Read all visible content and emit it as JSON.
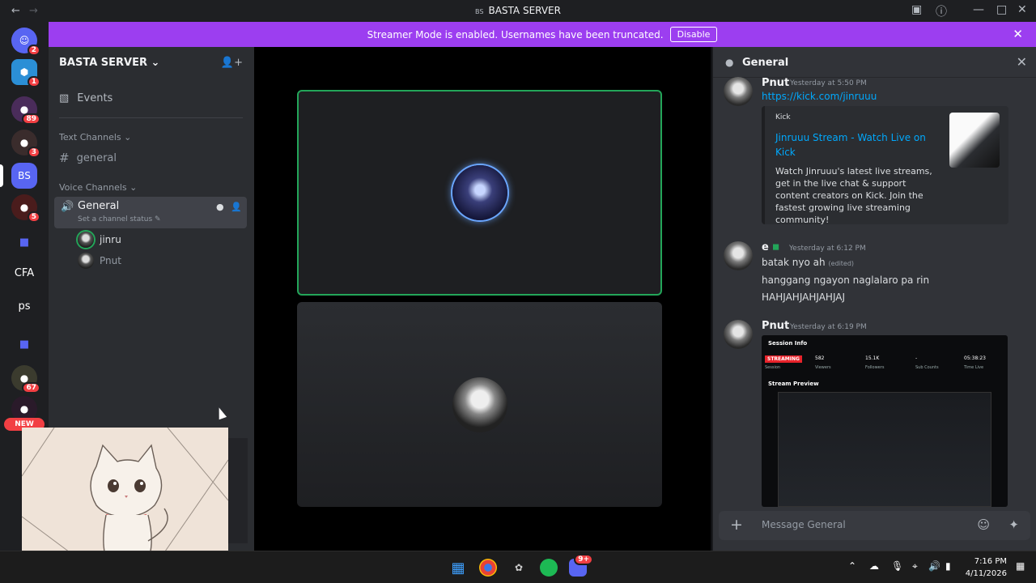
{
  "window": {
    "title": "BASTA SERVER",
    "server_badge": "BS"
  },
  "banner": {
    "text": "Streamer Mode is enabled. Usernames have been truncated.",
    "button": "Disable",
    "color": "#9c3ef0"
  },
  "rail": {
    "servers": [
      {
        "label": "",
        "icon": "discord-icon",
        "badge": "2"
      },
      {
        "label": "",
        "icon": "hexagon-app-icon",
        "badge": "1"
      },
      {
        "label": "",
        "icon": "anime-server-icon",
        "badge": "89"
      },
      {
        "label": "",
        "icon": "anime-server-icon",
        "badge": "3"
      },
      {
        "label": "BS",
        "icon": "",
        "badge": ""
      },
      {
        "label": "",
        "icon": "anime-server-icon",
        "badge": "5"
      },
      {
        "label": "",
        "icon": "folder-icon",
        "badge": ""
      },
      {
        "label": "CFA",
        "icon": "",
        "badge": ""
      },
      {
        "label": "ps",
        "icon": "",
        "badge": ""
      },
      {
        "label": "",
        "icon": "folder-icon",
        "badge": ""
      },
      {
        "label": "",
        "icon": "anime-server-icon",
        "badge": "67"
      },
      {
        "label": "",
        "icon": "anime-server-icon",
        "badge": ""
      }
    ],
    "new_tag": "NEW"
  },
  "sidebar": {
    "server_name": "BASTA SERVER",
    "events": "Events",
    "text_category": "Text Channels",
    "text_channels": [
      {
        "name": "general"
      }
    ],
    "voice_category": "Voice Channels",
    "voice_channel": {
      "name": "General",
      "status_placeholder": "Set a channel status"
    },
    "members": [
      {
        "name": "jinru",
        "speaking": true
      },
      {
        "name": "Pnut",
        "speaking": false
      }
    ]
  },
  "chat": {
    "title": "General",
    "messages": [
      {
        "author": "Pnut",
        "timestamp": "Yesterday at 5:50 PM",
        "link": "https://kick.com/jinruuu",
        "embed": {
          "provider": "Kick",
          "title": "Jinruuu Stream - Watch Live on Kick",
          "description": "Watch Jinruuu's latest live streams, get in the live chat & support content creators on Kick. Join the fastest growing live streaming community!"
        }
      },
      {
        "author": "e",
        "timestamp": "Yesterday at 6:12 PM",
        "lines": [
          "batak nyo ah",
          "hanggang ngayon naglalaro pa rin",
          "HAHJAHJAHJAHJAJ"
        ],
        "edited": "(edited)"
      },
      {
        "author": "Pnut",
        "timestamp": "Yesterday at 6:19 PM",
        "attachment": {
          "header": "Session Info",
          "live_tag": "STREAMING",
          "stats": [
            {
              "label": "Session",
              "value": ""
            },
            {
              "label": "Viewers",
              "value": "582"
            },
            {
              "label": "Followers",
              "value": "15.1K"
            },
            {
              "label": "Sub Counts",
              "value": "-"
            },
            {
              "label": "Time Live",
              "value": "05:38:23"
            }
          ],
          "preview": "Stream Preview"
        }
      }
    ],
    "composer_placeholder": "Message General"
  },
  "taskbar": {
    "time": "7:16 PM",
    "date": "4/11/2026",
    "discord_badge": "9+"
  },
  "colors": {
    "speaking": "#23a559",
    "link": "#00a8fc",
    "badge": "#f23f43"
  }
}
